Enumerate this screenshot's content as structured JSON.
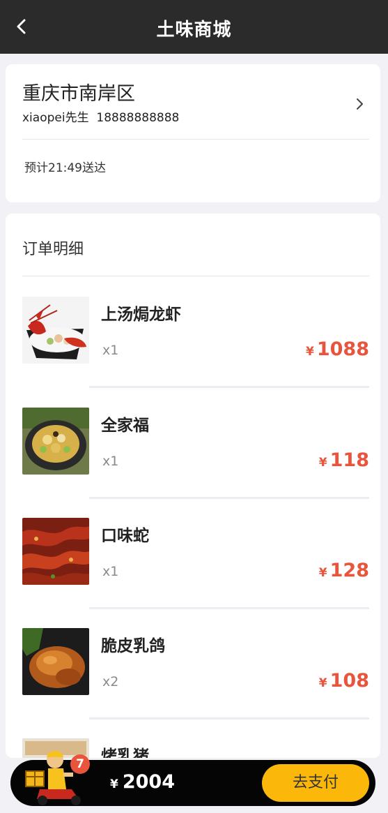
{
  "header": {
    "title": "土味商城",
    "back_icon": "chevron-left-icon"
  },
  "address": {
    "area": "重庆市南岸区",
    "contact": "xiaopei先生  18888888888",
    "eta": "预计21:49送达",
    "arrow_icon": "chevron-right-icon"
  },
  "order": {
    "heading": "订单明细",
    "currency": "¥",
    "items": [
      {
        "name": "上汤焗龙虾",
        "qty": "x1",
        "price": "1088",
        "image": "lobster-dish-image"
      },
      {
        "name": "全家福",
        "qty": "x1",
        "price": "118",
        "image": "family-hotpot-image"
      },
      {
        "name": "口味蛇",
        "qty": "x1",
        "price": "128",
        "image": "spicy-snake-image"
      },
      {
        "name": "脆皮乳鸽",
        "qty": "x2",
        "price": "108",
        "image": "roast-pigeon-image"
      },
      {
        "name": "烤乳猪",
        "qty": "",
        "price": "",
        "image": "roast-pig-image"
      }
    ]
  },
  "footer": {
    "cart_count": "7",
    "currency": "¥",
    "total": "2004",
    "pay_label": "去支付",
    "rider_icon": "delivery-rider-icon"
  },
  "colors": {
    "header_bg": "#2b2b2b",
    "price": "#e8543c",
    "pay_button": "#fbb80a",
    "bottom_bar": "#050505"
  }
}
